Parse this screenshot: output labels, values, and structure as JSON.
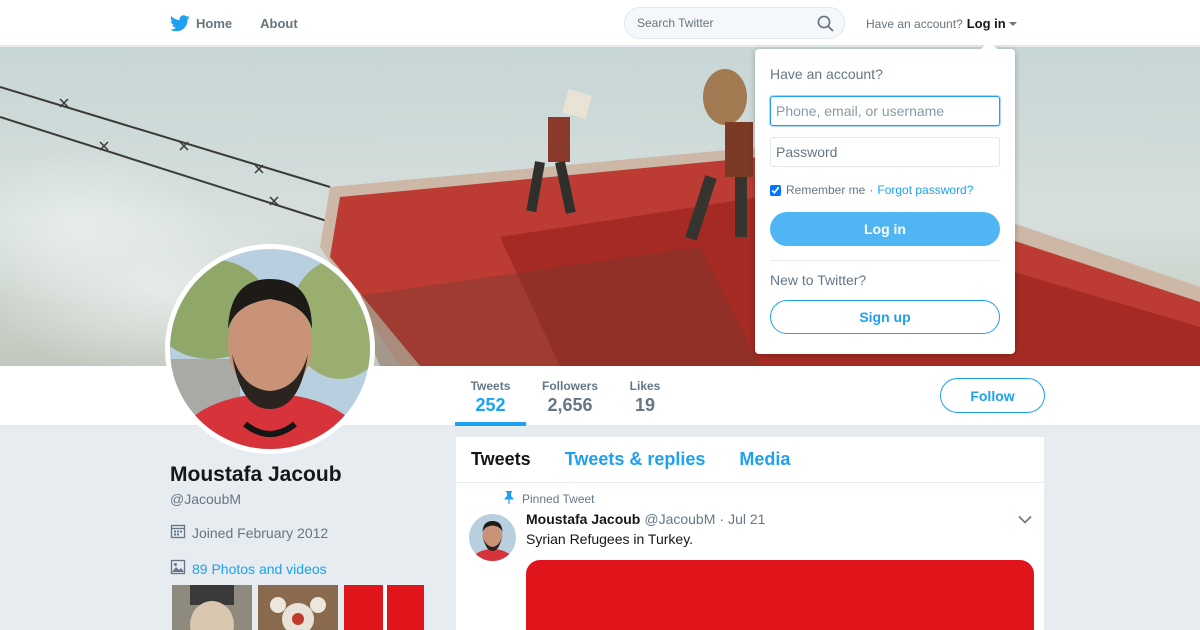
{
  "nav": {
    "home_label": "Home",
    "about_label": "About",
    "search_placeholder": "Search Twitter",
    "have_account": "Have an account?",
    "login_label": "Log in"
  },
  "profile": {
    "name": "Moustafa Jacoub",
    "handle": "@JacoubM",
    "joined": "Joined February 2012",
    "photos_link": "89 Photos and videos"
  },
  "stats": [
    {
      "label": "Tweets",
      "value": "252"
    },
    {
      "label": "Followers",
      "value": "2,656"
    },
    {
      "label": "Likes",
      "value": "19"
    }
  ],
  "follow_label": "Follow",
  "timeline": {
    "tabs": [
      "Tweets",
      "Tweets & replies",
      "Media"
    ],
    "pinned_label": "Pinned Tweet",
    "tweet": {
      "name": "Moustafa Jacoub",
      "handle": "@JacoubM",
      "separator": "·",
      "date": "Jul 21",
      "text": "Syrian Refugees in Turkey."
    }
  },
  "login_dropdown": {
    "title": "Have an account?",
    "username_placeholder": "Phone, email, or username",
    "password_placeholder": "Password",
    "remember_label": "Remember me",
    "separator": "·",
    "forgot_label": "Forgot password?",
    "login_button": "Log in",
    "new_label": "New to Twitter?",
    "signup_button": "Sign up"
  },
  "colors": {
    "brand_blue": "#1da1f2",
    "login_button_bg": "#4fb5f3",
    "page_bg": "#e6ecf0"
  }
}
